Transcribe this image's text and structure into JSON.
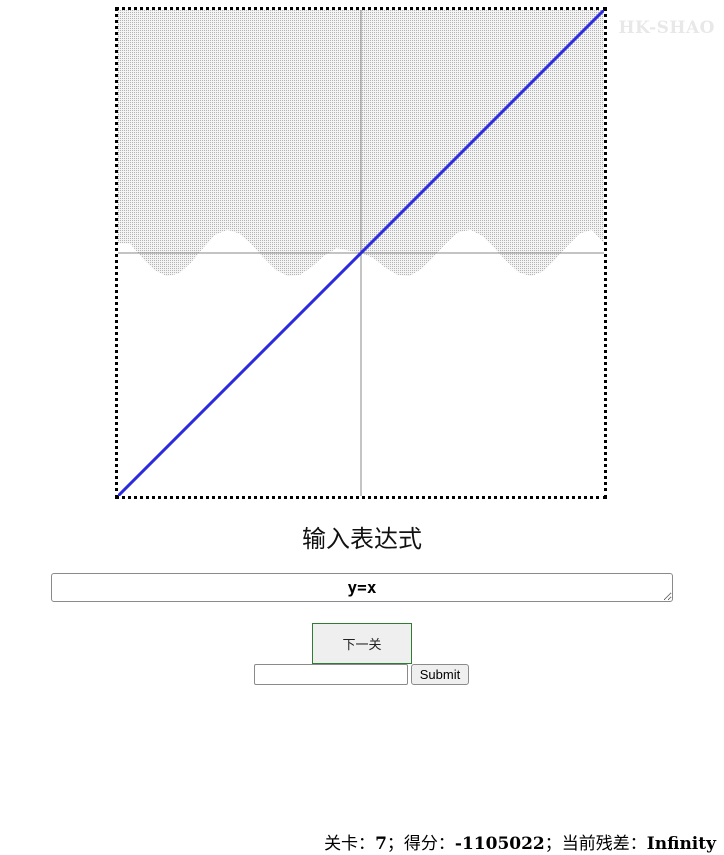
{
  "watermark": "HK-SHAO",
  "heading": "输入表达式",
  "expression": {
    "value": "y=x"
  },
  "next_button": "下一关",
  "text_field": {
    "value": ""
  },
  "submit_button": "Submit",
  "status": {
    "level_label": "关卡：",
    "level": "7",
    "sep1": "；得分：",
    "score": "-1105022",
    "sep2": "；当前残差：",
    "residual": "Infinity"
  },
  "chart_data": {
    "type": "line",
    "title": "",
    "xlabel": "",
    "ylabel": "",
    "xlim": [
      -10,
      10
    ],
    "ylim": [
      -10,
      10
    ],
    "grid": false,
    "axes": "center",
    "series": [
      {
        "x": [
          -10,
          10
        ],
        "y": [
          -10,
          10
        ],
        "color": "#2b2bdd"
      }
    ],
    "target_region": {
      "fill": "above-curve",
      "x": [
        -10,
        -9.5,
        -9,
        -8.5,
        -8,
        -7.5,
        -7,
        -6.5,
        -6,
        -5.5,
        -5,
        -4.5,
        -4,
        -3.5,
        -3,
        -2.5,
        -2,
        -1.5,
        -1,
        -0.5,
        0,
        0.5,
        1,
        1.5,
        2,
        2.5,
        3,
        3.5,
        4,
        4.5,
        5,
        5.5,
        6,
        6.5,
        7,
        7.5,
        8,
        8.5,
        9,
        9.5,
        10
      ],
      "y": [
        0.4,
        0.38,
        -0.2,
        -0.7,
        -0.95,
        -0.85,
        -0.4,
        0.2,
        0.75,
        0.95,
        0.8,
        0.35,
        -0.2,
        -0.7,
        -0.95,
        -0.9,
        -0.55,
        -0.1,
        0.2,
        0.1,
        0,
        -0.2,
        -0.6,
        -0.9,
        -0.95,
        -0.65,
        -0.15,
        0.4,
        0.85,
        0.95,
        0.7,
        0.2,
        -0.35,
        -0.8,
        -0.95,
        -0.75,
        -0.25,
        0.3,
        0.8,
        0.95,
        0.4
      ],
      "color": "#c9c9c9"
    }
  }
}
